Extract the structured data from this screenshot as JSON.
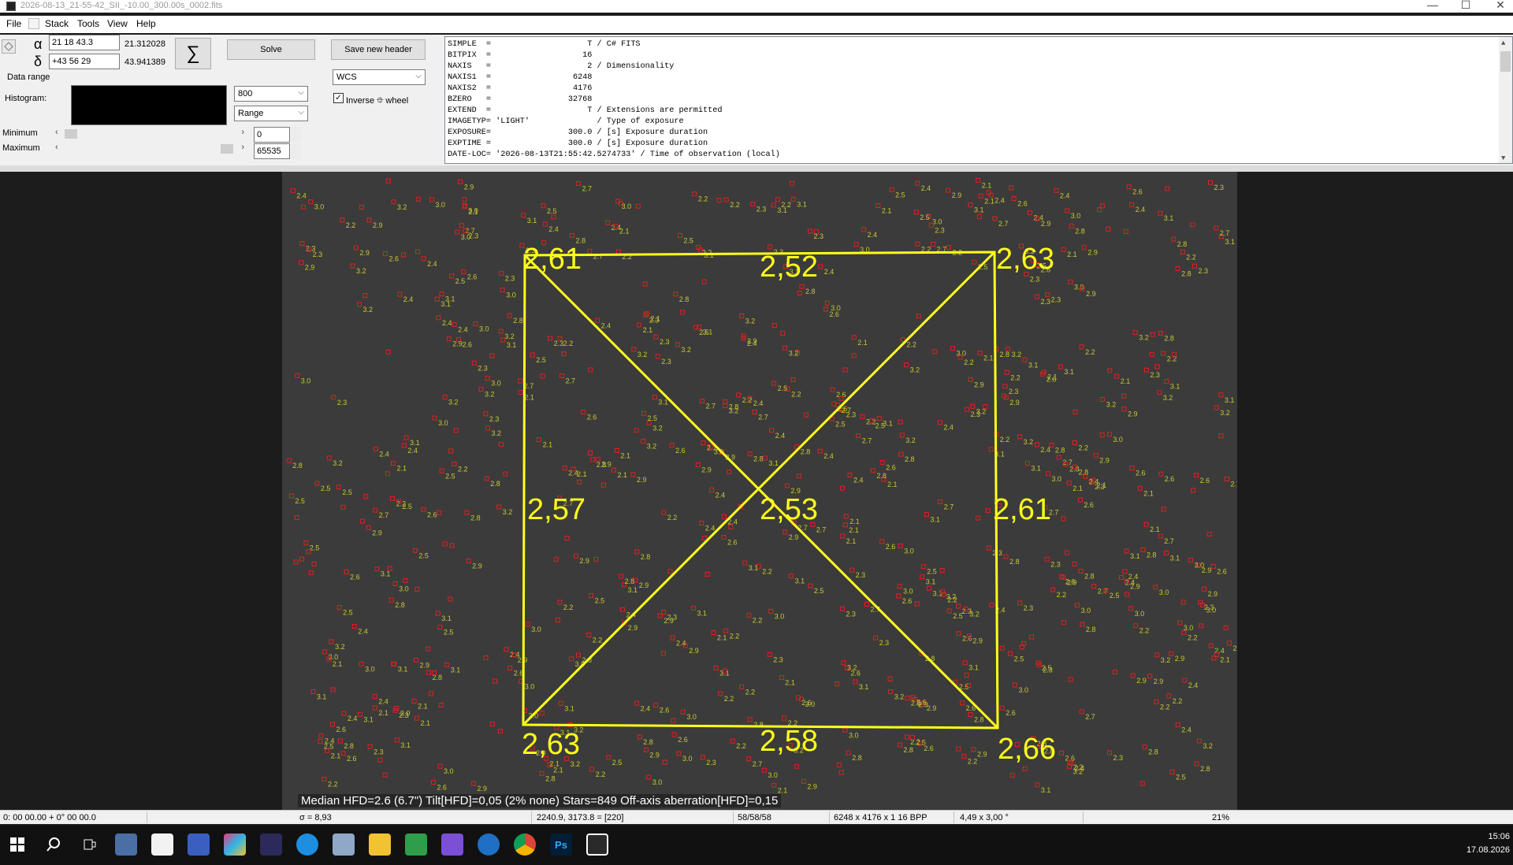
{
  "window": {
    "title": "2026-08-13_21-55-42_SII_-10.00_300.00s_0002.fits",
    "min": "—",
    "max": "☐",
    "close": "✕"
  },
  "menu": [
    "File",
    "Stack",
    "Tools",
    "View",
    "Help"
  ],
  "coords": {
    "alpha_symbol": "α",
    "delta_symbol": "δ",
    "ra_input": "21 18 43.3",
    "ra_decimal": "21.312028",
    "dec_input": "+43 56 29",
    "dec_decimal": "43.941389"
  },
  "buttons": {
    "sigma": "∑",
    "solve": "Solve",
    "save_header": "Save new header"
  },
  "labels": {
    "data_range": "Data range",
    "histogram": "Histogram:",
    "minimum": "Minimum",
    "maximum": "Maximum",
    "inverse": "Inverse ⯐ wheel"
  },
  "selects": {
    "value800": "800",
    "range": "Range",
    "wcs": "WCS"
  },
  "range": {
    "min": "0",
    "max": "65535"
  },
  "inverse_checked": true,
  "fits_header": [
    "SIMPLE  =                    T / C# FITS",
    "BITPIX  =                   16",
    "NAXIS   =                    2 / Dimensionality",
    "NAXIS1  =                 6248",
    "NAXIS2  =                 4176",
    "BZERO   =                32768",
    "EXTEND  =                    T / Extensions are permitted",
    "IMAGETYP= 'LIGHT'              / Type of exposure",
    "EXPOSURE=                300.0 / [s] Exposure duration",
    "EXPTIME =                300.0 / [s] Exposure duration",
    "DATE-LOC= '2026-08-13T21:55:42.5274733' / Time of observation (local)"
  ],
  "hfd_values": {
    "top_left": "2,61",
    "top": "2,52",
    "top_right": "2,63",
    "left": "2,57",
    "center": "2,53",
    "right": "2,61",
    "bottom_left": "2,63",
    "bottom": "2,58",
    "bottom_right": "2,66"
  },
  "summary": "Median HFD=2.6 (6.7\")  Tilt[HFD]=0,05 (2% none)  Stars=849  Off-axis aberration[HFD]=0,15",
  "status": {
    "position": "0: 00  00.00   + 0° 00  00.0",
    "sigma": "σ = 8,93",
    "pixel": "2240.9, 3173.8 = [220]",
    "counts": "58/58/58",
    "dimensions": "6248 x 4176 x 1   16 BPP",
    "fov": "4,49 x 3,00 °",
    "zoom": "21%"
  },
  "clock": {
    "time": "15:06",
    "date": "17.08.2026"
  },
  "colors": {
    "overlay": "#ffff1a",
    "star_marker": "#e02020",
    "image_bg": "#3b3b3b"
  },
  "taskbar_icons": [
    "windows-start",
    "search",
    "task-view",
    "calculator",
    "notepad",
    "save-disk",
    "photos",
    "astro-app",
    "mail",
    "notes",
    "file-explorer",
    "spreadsheet",
    "obsidian",
    "thunderbird",
    "chrome",
    "photoshop",
    "astap"
  ]
}
